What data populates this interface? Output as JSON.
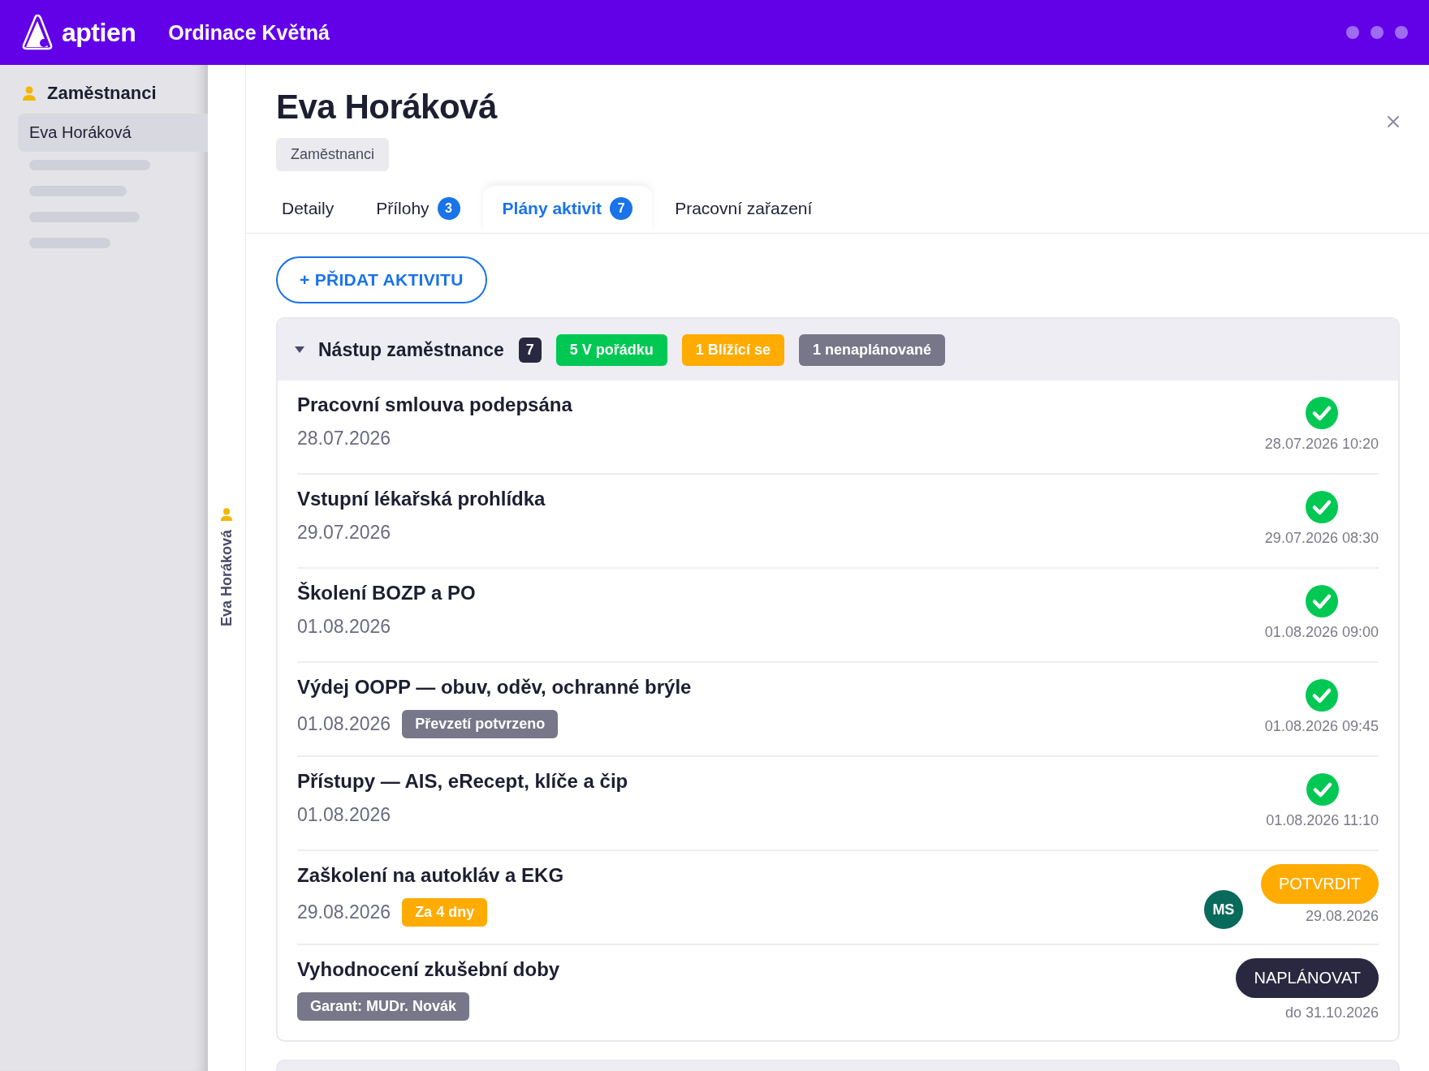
{
  "app": {
    "logo": "aptien",
    "workspace": "Ordinace Květná"
  },
  "sidebar": {
    "section": "Zaměstnanci",
    "items": [
      {
        "label": "Eva Horáková",
        "selected": true
      }
    ],
    "collapsed_label": "Eva Horáková"
  },
  "detail": {
    "title": "Eva Horáková",
    "category": "Zaměstnanci",
    "tabs": [
      {
        "label": "Detaily",
        "selected": false
      },
      {
        "label": "Přílohy",
        "count": "3",
        "selected": false
      },
      {
        "label": "Plány aktivit",
        "count": "7",
        "selected": true
      },
      {
        "label": "Pracovní zařazení",
        "selected": false
      }
    ],
    "add_button": "+ PŘIDAT AKTIVITU",
    "group": {
      "title": "Nástup zaměstnance",
      "expanded": true,
      "count": "7",
      "badges": [
        {
          "text": "5 V pořádku",
          "color": "#00c853"
        },
        {
          "text": "1 Blížící se",
          "color": "#ffab00"
        },
        {
          "text": "1 nenaplánované",
          "color": "#777789"
        }
      ],
      "rows": [
        {
          "title": "Pracovní smlouva podepsána",
          "date": "28.07.2026",
          "kind": "done",
          "when": "28.07.2026 10:20"
        },
        {
          "title": "Vstupní lékařská prohlídka",
          "date": "29.07.2026",
          "kind": "done",
          "when": "29.07.2026 08:30"
        },
        {
          "title": "Školení BOZP a PO",
          "date": "01.08.2026",
          "kind": "done",
          "when": "01.08.2026 09:00"
        },
        {
          "title": "Výdej OOPP — obuv, oděv, ochranné brýle",
          "date": "01.08.2026",
          "tag": {
            "text": "Převzetí potvrzeno",
            "color": "#777789"
          },
          "kind": "done",
          "when": "01.08.2026 09:45"
        },
        {
          "title": "Přístupy — AIS, eRecept, klíče a čip",
          "date": "01.08.2026",
          "kind": "done",
          "when": "01.08.2026 11:10"
        },
        {
          "title": "Zaškolení na autokláv a EKG",
          "date": "29.08.2026",
          "tag": {
            "text": "Za 4 dny",
            "color": "#ffab00"
          },
          "kind": "confirm",
          "avatar": "MS",
          "action": "POTVRDIT",
          "when": "29.08.2026"
        },
        {
          "title": "Vyhodnocení zkušební doby",
          "tag": {
            "text": "Garant: MUDr. Novák",
            "color": "#777789"
          },
          "kind": "schedule",
          "action": "NAPLÁNOVAT",
          "when": "do 31.10.2026"
        }
      ]
    }
  }
}
